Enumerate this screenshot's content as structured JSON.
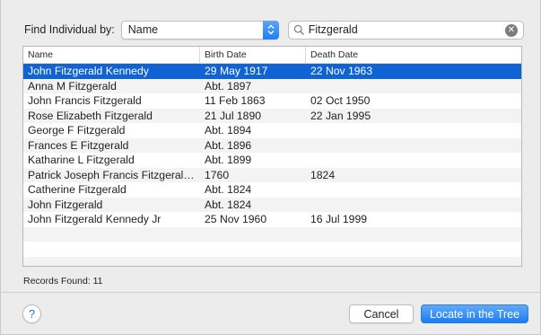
{
  "find": {
    "label": "Find Individual by:",
    "field_value": "Name",
    "search_value": "Fitzgerald",
    "search_placeholder": "Search"
  },
  "table": {
    "columns": [
      "Name",
      "Birth Date",
      "Death Date"
    ],
    "rows": [
      {
        "name": "John Fitzgerald Kennedy",
        "birth": "29 May 1917",
        "death": "22 Nov 1963",
        "selected": true
      },
      {
        "name": "Anna M Fitzgerald",
        "birth": "Abt. 1897",
        "death": ""
      },
      {
        "name": "John Francis Fitzgerald",
        "birth": "11 Feb 1863",
        "death": "02 Oct 1950"
      },
      {
        "name": "Rose Elizabeth Fitzgerald",
        "birth": "21 Jul 1890",
        "death": "22 Jan 1995"
      },
      {
        "name": "George F Fitzgerald",
        "birth": "Abt. 1894",
        "death": ""
      },
      {
        "name": "Frances E Fitzgerald",
        "birth": "Abt. 1896",
        "death": ""
      },
      {
        "name": "Katharine L Fitzgerald",
        "birth": "Abt. 1899",
        "death": ""
      },
      {
        "name": "Patrick Joseph Francis Fitzgerald H...",
        "birth": "1760",
        "death": "1824"
      },
      {
        "name": "Catherine Fitzgerald",
        "birth": "Abt. 1824",
        "death": ""
      },
      {
        "name": "John Fitzgerald",
        "birth": "Abt. 1824",
        "death": ""
      },
      {
        "name": "John Fitzgerald Kennedy Jr",
        "birth": "25 Nov 1960",
        "death": "16 Jul 1999"
      }
    ],
    "empty_rows": 3
  },
  "status": {
    "records_found": "Records Found:  11"
  },
  "footer": {
    "help_label": "?",
    "cancel_label": "Cancel",
    "locate_label": "Locate in the Tree"
  },
  "colors": {
    "selection": "#0f63d3",
    "accent": "#1e7cf0"
  },
  "icons": {
    "search": "search-icon",
    "clear": "clear-search-icon",
    "popup": "chevron-updown-icon"
  }
}
